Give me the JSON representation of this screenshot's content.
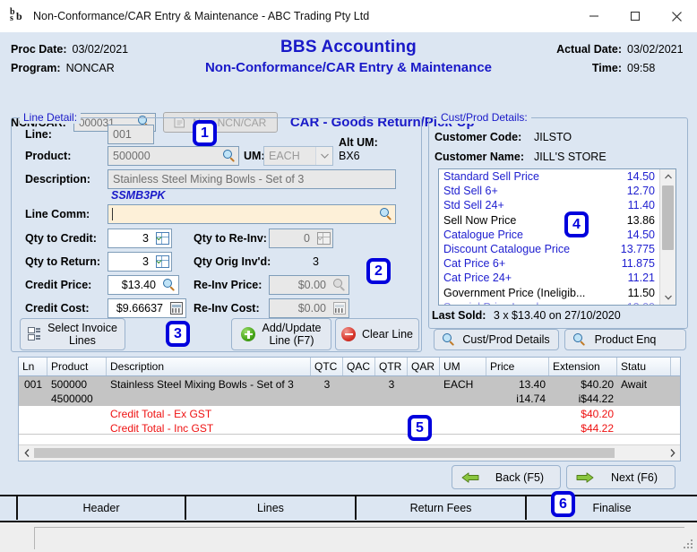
{
  "window": {
    "title": "Non-Conformance/CAR Entry & Maintenance - ABC Trading Pty Ltd",
    "icon": "bbs-logo-icon",
    "minimize": "minimize-icon",
    "maximize": "maximize-icon",
    "close": "close-icon"
  },
  "header": {
    "proc_date_label": "Proc Date:",
    "proc_date_value": "03/02/2021",
    "program_label": "Program:",
    "program_value": "NONCAR",
    "title_line1": "BBS Accounting",
    "title_line2": "Non-Conformance/CAR Entry & Maintenance",
    "actual_date_label": "Actual Date:",
    "actual_date_value": "03/02/2021",
    "time_label": "Time:",
    "time_value": "09:58",
    "ncn_label": "NCN/CAR:",
    "ncn_value": "000031",
    "new_ncn_button": "New NCN/CAR",
    "doc_type_title": "CAR - Goods Return/Pick-Up"
  },
  "line_detail": {
    "legend": "Line Detail:",
    "line_label": "Line:",
    "line_value": "001",
    "product_label": "Product:",
    "product_value": "500000",
    "um_label": "UM:",
    "um_value": "EACH",
    "alt_um_label": "Alt UM:",
    "alt_um_value": "BX6",
    "description_label": "Description:",
    "description_value": "Stainless Steel Mixing Bowls - Set of 3",
    "product_code": "SSMB3PK",
    "line_comm_label": "Line Comm:",
    "line_comm_value": "",
    "qty_to_credit_label": "Qty to Credit:",
    "qty_to_credit_value": "3",
    "qty_to_reinv_label": "Qty to Re-Inv:",
    "qty_to_reinv_value": "0",
    "qty_to_return_label": "Qty to Return:",
    "qty_to_return_value": "3",
    "qty_orig_invd_label": "Qty Orig Inv'd:",
    "qty_orig_invd_value": "3",
    "credit_price_label": "Credit Price:",
    "credit_price_value": "$13.40",
    "reinv_price_label": "Re-Inv Price:",
    "reinv_price_value": "$0.00",
    "credit_cost_label": "Credit Cost:",
    "credit_cost_value": "$9.66637",
    "reinv_cost_label": "Re-Inv Cost:",
    "reinv_cost_value": "$0.00",
    "select_invoice_lines_button": "Select Invoice\nLines",
    "select_invoice_lines_line1": "Select Invoice",
    "select_invoice_lines_line2": "Lines",
    "add_update_line1": "Add/Update",
    "add_update_line2": "Line (F7)",
    "clear_line_button": "Clear Line"
  },
  "cust_prod": {
    "legend": "Cust/Prod Details:",
    "customer_code_label": "Customer Code:",
    "customer_code_value": "JILSTO",
    "customer_name_label": "Customer Name:",
    "customer_name_value": "JILL'S STORE",
    "price_rows": [
      {
        "name": "Standard Sell Price",
        "value": "14.50",
        "color": "blue"
      },
      {
        "name": "Std Sell 6+",
        "value": "12.70",
        "color": "blue"
      },
      {
        "name": "Std Sell 24+",
        "value": "11.40",
        "color": "blue"
      },
      {
        "name": "Sell Now Price",
        "value": "13.86",
        "color": "black"
      },
      {
        "name": "Catalogue Price",
        "value": "14.50",
        "color": "blue"
      },
      {
        "name": "Discount Catalogue Price",
        "value": "13.775",
        "color": "blue"
      },
      {
        "name": "Cat Price 6+",
        "value": "11.875",
        "color": "blue"
      },
      {
        "name": "Cat Price 24+",
        "value": "11.21",
        "color": "blue"
      },
      {
        "name": "Government Price (Ineligib...",
        "value": "11.50",
        "color": "black"
      }
    ],
    "last_sold_label": "Last Sold:",
    "last_sold_value": "3 x $13.40 on 27/10/2020",
    "cust_prod_details_button": "Cust/Prod Details",
    "product_enq_button": "Product Enq"
  },
  "grid": {
    "columns": [
      "Ln",
      "Product",
      "Description",
      "QTC",
      "QAC",
      "QTR",
      "QAR",
      "UM",
      "Price",
      "Extension",
      "Statu"
    ],
    "rows": [
      {
        "ln": "001",
        "product": "500000",
        "product2": "4500000",
        "description": "Stainless Steel Mixing Bowls - Set of 3",
        "qtc": "3",
        "qac": "",
        "qtr": "3",
        "qar": "",
        "um": "EACH",
        "price": "13.40",
        "price2": "i14.74",
        "extension": "$40.20",
        "extension2": "i$44.22",
        "status": "Await"
      }
    ],
    "totals": [
      {
        "label": "Credit Total - Ex GST",
        "value": "$40.20"
      },
      {
        "label": "Credit Total - Inc GST",
        "value": "$44.22"
      }
    ]
  },
  "nav": {
    "back_button": "Back (F5)",
    "next_button": "Next (F6)"
  },
  "tabs": [
    {
      "label": "Header",
      "active": false
    },
    {
      "label": "Lines",
      "active": true
    },
    {
      "label": "Return Fees",
      "active": false
    },
    {
      "label": "Finalise",
      "active": false
    }
  ],
  "callouts": [
    "1",
    "2",
    "3",
    "4",
    "5",
    "6"
  ],
  "colors": {
    "accent_blue": "#1919c8",
    "callout_blue": "#0000dd",
    "total_red": "#ee1111",
    "panel_bg": "#dce6f2",
    "focus_field": "#fdf0d8"
  }
}
